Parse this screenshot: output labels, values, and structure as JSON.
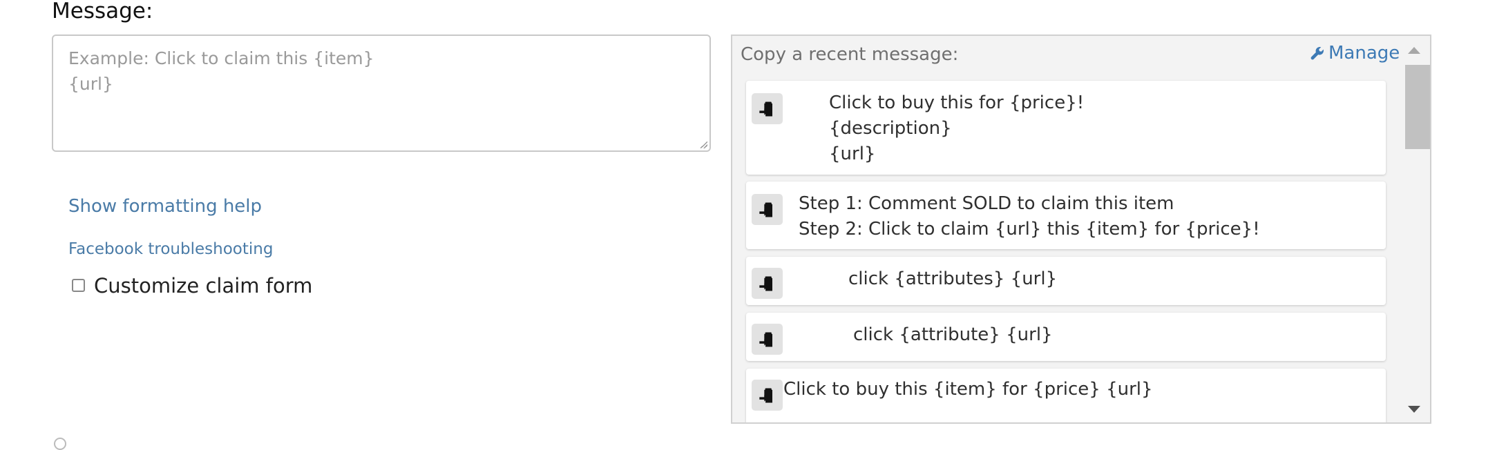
{
  "message": {
    "label": "Message:",
    "placeholder": "Example: Click to claim this {item}\n{url}"
  },
  "links": {
    "formatting_help": "Show formatting help",
    "facebook_troubleshooting": "Facebook troubleshooting"
  },
  "customize": {
    "label": "Customize claim form",
    "checked": false
  },
  "recent": {
    "title": "Copy a recent message:",
    "manage_label": "Manage",
    "items": [
      {
        "text": "Click to buy this for {price}!\n{description}\n{url}"
      },
      {
        "text": "Step 1: Comment SOLD to claim this item\nStep 2: Click to claim {url} this {item} for {price}!"
      },
      {
        "text": "click {attributes} {url}"
      },
      {
        "text": "click {attribute} {url}"
      },
      {
        "text": "Click to buy this {item} for {price} {url}"
      }
    ]
  },
  "colors": {
    "link": "#4a7ba7",
    "manage": "#3d7ab5",
    "panel_bg": "#f3f3f3"
  },
  "icons": {
    "copy": "clipboard-paste-icon",
    "manage": "wrench-icon"
  }
}
